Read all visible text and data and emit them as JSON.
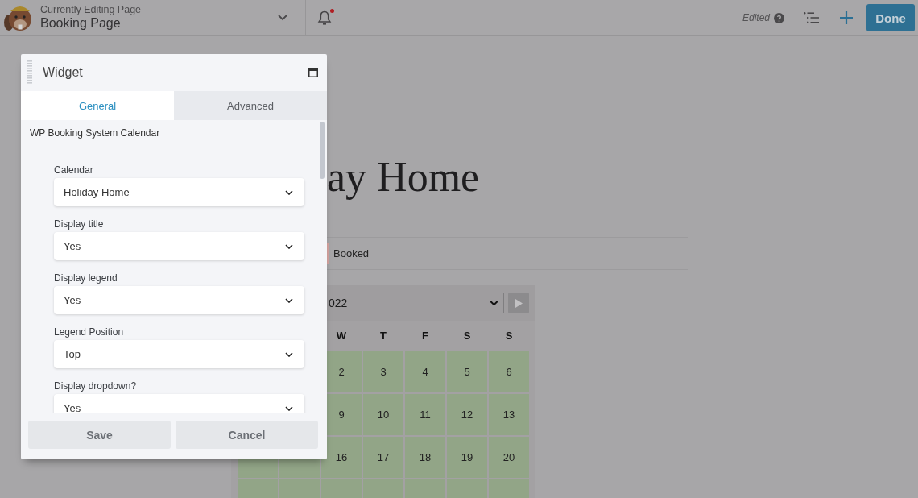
{
  "top_bar": {
    "context_label": "Currently Editing Page",
    "page_title": "Booking Page",
    "notifications": {
      "unread": true
    },
    "status": "Edited",
    "done_button": "Done"
  },
  "page": {
    "title": "ay Home",
    "legend": [
      {
        "label": "Booked",
        "color": "#d6a4a0"
      }
    ],
    "calendar": {
      "month_select": "022",
      "weekdays": [
        "W",
        "T",
        "F",
        "S",
        "S"
      ],
      "weeks": [
        {
          "days": [
            "2",
            "3",
            "4",
            "5",
            "6"
          ]
        },
        {
          "days": [
            "9",
            "10",
            "11",
            "12",
            "13"
          ]
        },
        {
          "days": [
            "16",
            "17",
            "18",
            "19",
            "20"
          ]
        }
      ]
    }
  },
  "widget_panel": {
    "title": "Widget",
    "tabs": [
      {
        "label": "General",
        "selected": true
      },
      {
        "label": "Advanced",
        "selected": false
      }
    ],
    "widget_name": "WP Booking System Calendar",
    "fields": [
      {
        "label": "Calendar",
        "value": "Holiday Home"
      },
      {
        "label": "Display title",
        "value": "Yes"
      },
      {
        "label": "Display legend",
        "value": "Yes"
      },
      {
        "label": "Legend Position",
        "value": "Top"
      },
      {
        "label": "Display dropdown?",
        "value": "Yes"
      }
    ],
    "buttons": [
      "Save",
      "Cancel"
    ]
  }
}
